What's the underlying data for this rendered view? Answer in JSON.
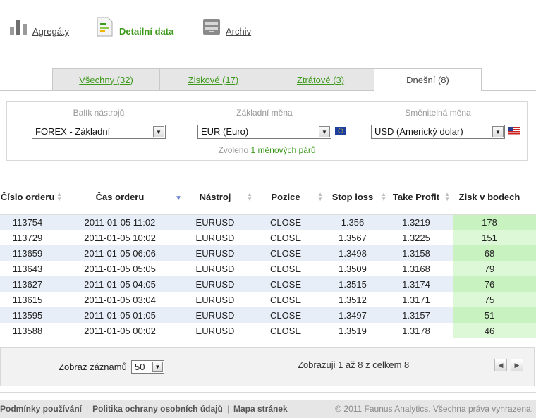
{
  "nav": [
    {
      "label": "Agregáty",
      "icon": "bar-chart-icon",
      "active": false
    },
    {
      "label": "Detailní data",
      "icon": "document-data-icon",
      "active": true
    },
    {
      "label": "Archiv",
      "icon": "archive-icon",
      "active": false
    }
  ],
  "tabs": [
    "Všechny (32)",
    "Ziskové (17)",
    "Ztrátové (3)",
    "Dnešní (8)"
  ],
  "filters": {
    "instrument_label": "Balík nástrojů",
    "instrument_value": "FOREX - Základní",
    "base_label": "Základní měna",
    "base_value": "EUR (Euro)",
    "quote_label": "Směnitelná měna",
    "quote_value": "USD (Americký dolar)",
    "chosen_prefix": "Zvoleno",
    "chosen_link": "1 měnových párů"
  },
  "table": {
    "headers": [
      "Číslo orderu",
      "Čas orderu",
      "Nástroj",
      "Pozice",
      "Stop loss",
      "Take Profit",
      "Zisk v bodech"
    ],
    "rows": [
      [
        "113754",
        "2011-01-05 11:02",
        "EURUSD",
        "CLOSE",
        "1.356",
        "1.3219",
        "178"
      ],
      [
        "113729",
        "2011-01-05 10:02",
        "EURUSD",
        "CLOSE",
        "1.3567",
        "1.3225",
        "151"
      ],
      [
        "113659",
        "2011-01-05 06:06",
        "EURUSD",
        "CLOSE",
        "1.3498",
        "1.3158",
        "68"
      ],
      [
        "113643",
        "2011-01-05 05:05",
        "EURUSD",
        "CLOSE",
        "1.3509",
        "1.3168",
        "79"
      ],
      [
        "113627",
        "2011-01-05 04:05",
        "EURUSD",
        "CLOSE",
        "1.3515",
        "1.3174",
        "76"
      ],
      [
        "113615",
        "2011-01-05 03:04",
        "EURUSD",
        "CLOSE",
        "1.3512",
        "1.3171",
        "75"
      ],
      [
        "113595",
        "2011-01-05 01:05",
        "EURUSD",
        "CLOSE",
        "1.3497",
        "1.3157",
        "51"
      ],
      [
        "113588",
        "2011-01-05 00:02",
        "EURUSD",
        "CLOSE",
        "1.3519",
        "1.3178",
        "46"
      ]
    ]
  },
  "pager": {
    "show_label": "Zobraz záznamů",
    "page_size": "50",
    "info": "Zobrazuji 1 až 8 z celkem 8"
  },
  "footer": {
    "links": [
      "Podmínky používání",
      "Politika ochrany osobních údajů",
      "Mapa stránek"
    ],
    "separator": "|",
    "copyright": "© 2011 Faunus Analytics. Všechna práva vyhrazena."
  },
  "colors": {
    "accent_green": "#3d9a1c",
    "profit_cell": "#c8f2c0",
    "row_stripe": "#e8eef8"
  }
}
